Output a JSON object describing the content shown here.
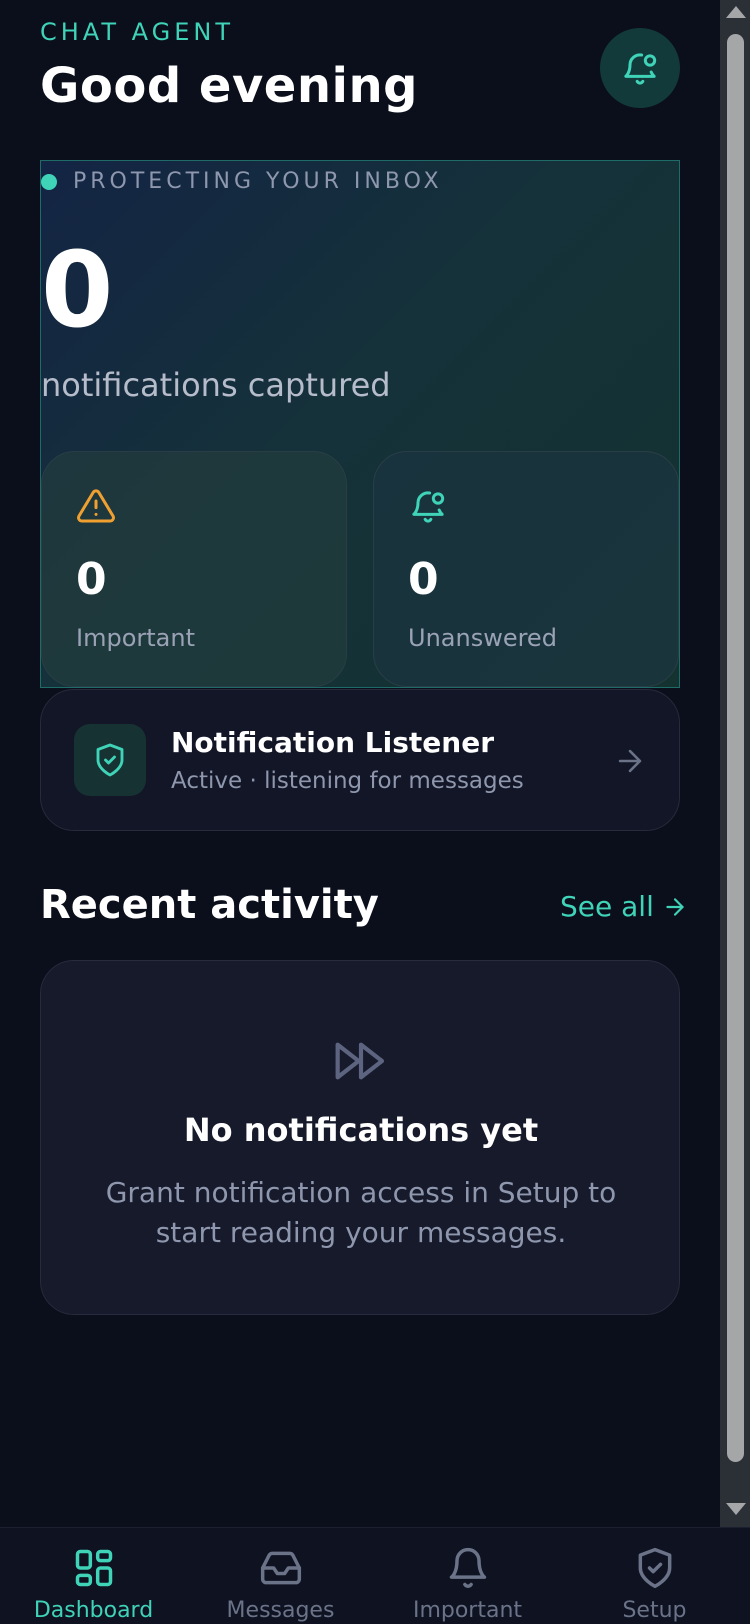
{
  "header": {
    "eyebrow": "CHAT AGENT",
    "greeting": "Good evening",
    "bell_icon": "bell-dot-icon"
  },
  "hero": {
    "status_text": "PROTECTING YOUR INBOX",
    "count": "0",
    "caption": "notifications captured",
    "stats": [
      {
        "icon": "warning-triangle-icon",
        "value": "0",
        "label": "Important",
        "icon_color": "#f0a030"
      },
      {
        "icon": "bell-dot-icon",
        "value": "0",
        "label": "Unanswered",
        "icon_color": "#3fd3b8"
      }
    ]
  },
  "listener": {
    "icon": "shield-check-icon",
    "title": "Notification Listener",
    "subtitle": "Active · listening for messages"
  },
  "recent": {
    "title": "Recent activity",
    "see_all": "See all",
    "empty_icon": "fast-forward-icon",
    "empty_title": "No notifications yet",
    "empty_desc": "Grant notification access in Setup to start reading your messages."
  },
  "nav": {
    "items": [
      {
        "label": "Dashboard",
        "icon": "grid-icon",
        "active": true
      },
      {
        "label": "Messages",
        "icon": "inbox-icon",
        "active": false
      },
      {
        "label": "Important",
        "icon": "bell-icon",
        "active": false
      },
      {
        "label": "Setup",
        "icon": "shield-check-icon",
        "active": false
      }
    ]
  },
  "colors": {
    "background": "#0b0e1b",
    "accent": "#3fd3b8",
    "warning": "#f0a030",
    "muted": "#8e97ad"
  }
}
